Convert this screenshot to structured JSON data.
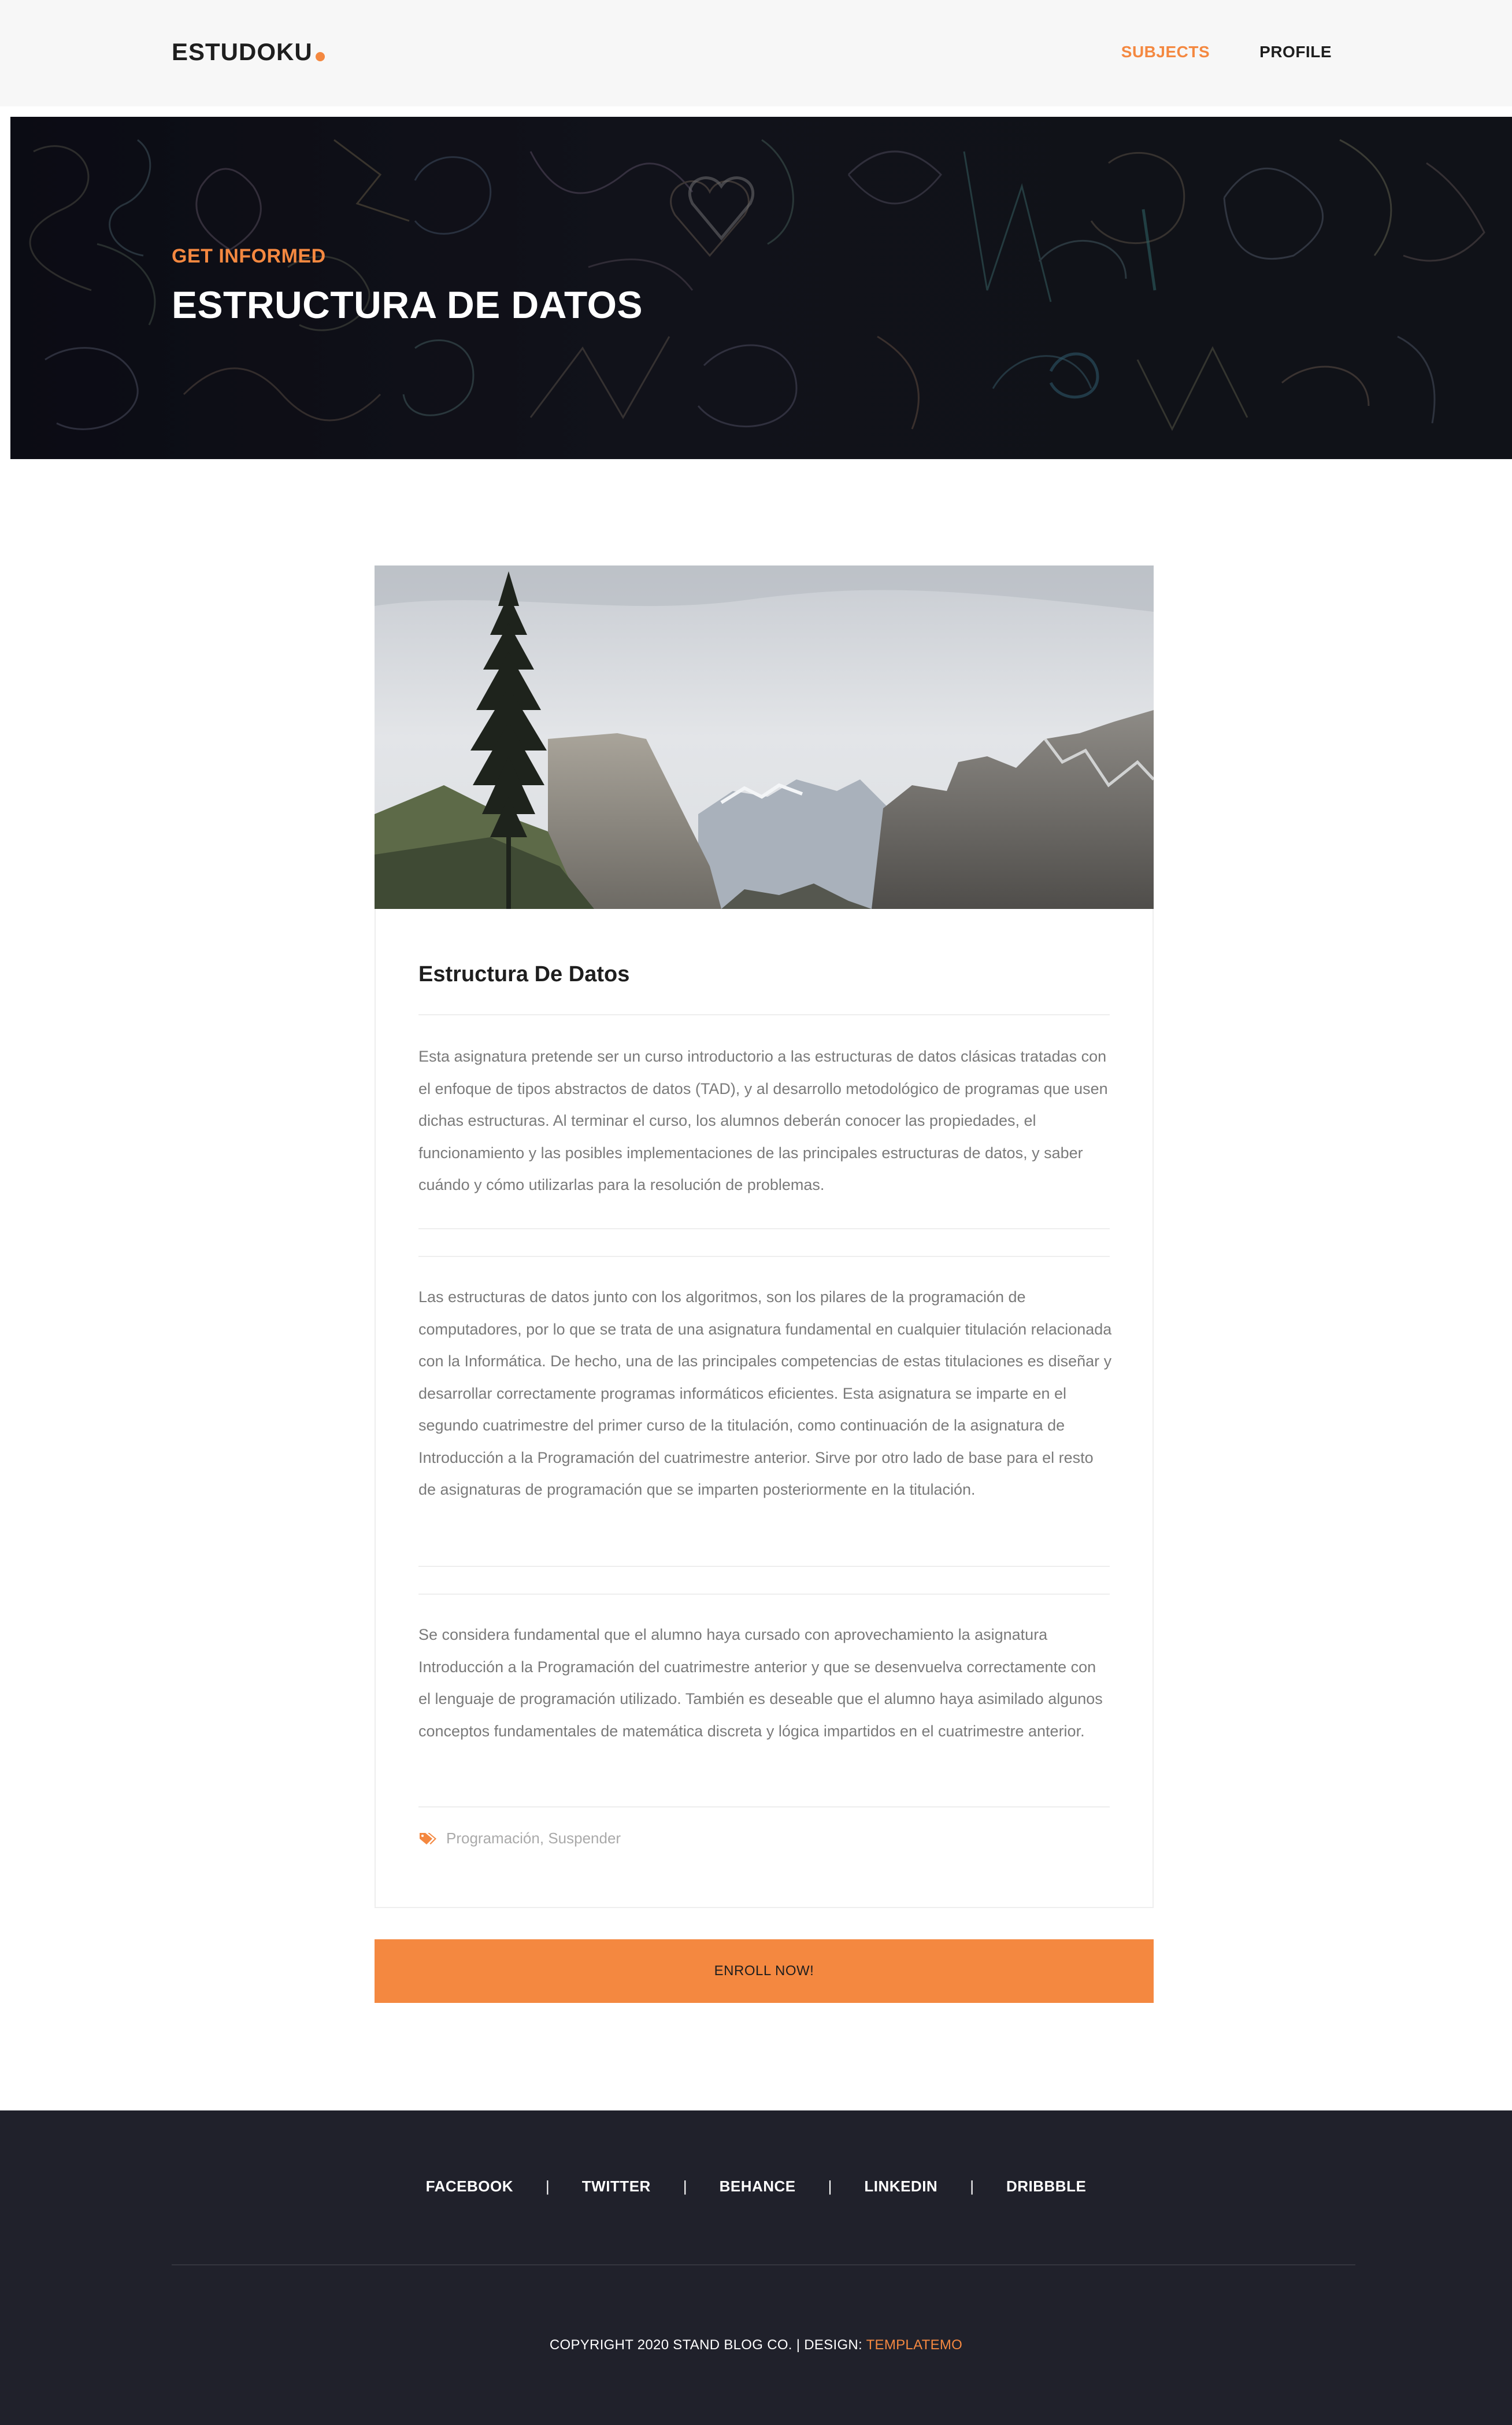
{
  "header": {
    "logo": "ESTUDOKU",
    "nav": [
      {
        "label": "SUBJECTS",
        "active": true
      },
      {
        "label": "PROFILE",
        "active": false
      }
    ]
  },
  "hero": {
    "kicker": "GET INFORMED",
    "title": "ESTRUCTURA DE DATOS"
  },
  "post": {
    "title": "Estructura De Datos",
    "paragraphs": [
      "Esta asignatura pretende ser un curso introductorio a las estructuras de datos clásicas tratadas con el enfoque de tipos abstractos de datos (TAD), y al desarrollo metodológico de programas que usen dichas estructuras. Al terminar el curso, los alumnos deberán conocer las propiedades, el funcionamiento y las posibles implementaciones de las principales estructuras de datos, y saber cuándo y cómo utilizarlas para la resolución de problemas.",
      "Las estructuras de datos junto con los algoritmos, son los pilares de la programación de computadores, por lo que se trata de una asignatura fundamental en cualquier titulación relacionada con la Informática. De hecho, una de las principales competencias de estas titulaciones es diseñar y desarrollar correctamente programas informáticos eficientes. Esta asignatura se imparte en el segundo cuatrimestre del primer curso de la titulación, como continuación de la asignatura de Introducción a la Programación del cuatrimestre anterior. Sirve por otro lado de base para el resto de asignaturas de programación que se imparten posteriormente en la titulación.",
      "Se considera fundamental que el alumno haya cursado con aprovechamiento la asignatura Introducción a la Programación del cuatrimestre anterior y que se desenvuelva correctamente con el lenguaje de programación utilizado. También es deseable que el alumno haya asimilado algunos conceptos fundamentales de matemática discreta y lógica impartidos en el cuatrimestre anterior."
    ],
    "tags": [
      "Programación",
      "Suspender"
    ],
    "tag_separator": ", "
  },
  "enroll_label": "ENROLL NOW!",
  "footer": {
    "social": [
      "FACEBOOK",
      "TWITTER",
      "BEHANCE",
      "LINKEDIN",
      "DRIBBBLE"
    ],
    "separator": "|",
    "copyright": "COPYRIGHT 2020 STAND BLOG CO. | DESIGN: ",
    "design_link": "TEMPLATEMO"
  },
  "colors": {
    "accent": "#f48840",
    "footer_bg": "#20212b",
    "header_bg": "#f7f7f7"
  },
  "icons": {
    "tags": "tags-icon",
    "logo_dot": "dot-icon"
  }
}
